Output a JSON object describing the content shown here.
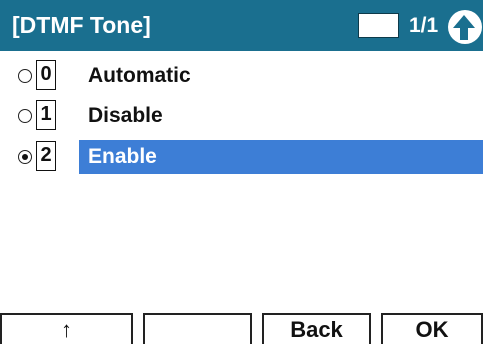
{
  "header": {
    "title": "[DTMF Tone]",
    "page": "1/1",
    "nav_icon": "up-arrow-icon",
    "background_color": "#1a6f8f"
  },
  "options": [
    {
      "key": "0",
      "label": "Automatic",
      "selected": false
    },
    {
      "key": "1",
      "label": "Disable",
      "selected": false
    },
    {
      "key": "2",
      "label": "Enable",
      "selected": true
    }
  ],
  "highlight_color": "#3d7ed6",
  "softkeys": [
    "↑",
    "",
    "Back",
    "OK"
  ]
}
